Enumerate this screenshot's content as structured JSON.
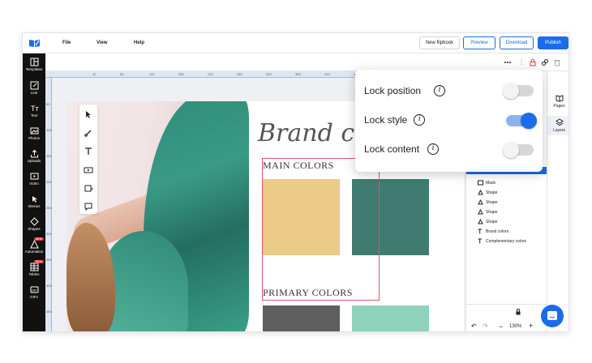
{
  "menu": {
    "file": "File",
    "view": "View",
    "help": "Help"
  },
  "topbar": {
    "new_flipbook": "New flipbook",
    "preview": "Preview",
    "download": "Download",
    "publish": "Publish"
  },
  "leftnav": {
    "items": [
      {
        "label": "Templates",
        "icon": "templates-icon"
      },
      {
        "label": "Link",
        "icon": "link-icon"
      },
      {
        "label": "Text",
        "icon": "text-icon"
      },
      {
        "label": "Photos",
        "icon": "photos-icon"
      },
      {
        "label": "Uploads",
        "icon": "upload-icon"
      },
      {
        "label": "Video",
        "icon": "video-icon"
      },
      {
        "label": "Interact",
        "icon": "interact-icon"
      },
      {
        "label": "Shapes",
        "icon": "shapes-icon"
      },
      {
        "label": "Automation",
        "icon": "automation-icon",
        "badge": "NEW"
      },
      {
        "label": "Tables",
        "icon": "tables-icon",
        "badge": "NEW"
      },
      {
        "label": "GIFs",
        "icon": "gifs-icon"
      }
    ]
  },
  "ruler": {
    "h_ticks": [
      "10",
      "50",
      "110",
      "150",
      "210",
      "250",
      "310",
      "350",
      "410",
      "450",
      "500"
    ],
    "v_ticks": [
      "50",
      "100",
      "150",
      "200",
      "250",
      "300",
      "350",
      "400",
      "450",
      "500"
    ]
  },
  "canvas": {
    "brand_title": "Brand col",
    "main_colors": "MAIN COLORS",
    "primary_colors": "PRIMARY COLORS",
    "swatch_colors": [
      "#ecca87",
      "#3f7b71",
      "#5e5e5e",
      "#8fd2bb"
    ]
  },
  "lock_popup": {
    "rows": [
      {
        "label": "Lock position",
        "on": false
      },
      {
        "label": "Lock style",
        "on": true
      },
      {
        "label": "Lock content",
        "on": false
      }
    ]
  },
  "rail": {
    "pages": "Pages",
    "layers": "Layers"
  },
  "layers": {
    "items": [
      {
        "label": "Mask",
        "icon": "mask-icon"
      },
      {
        "label": "Shape",
        "icon": "shape-icon"
      },
      {
        "label": "Shape",
        "icon": "shape-icon"
      },
      {
        "label": "Shape",
        "icon": "shape-icon"
      },
      {
        "label": "Shape",
        "icon": "shape-icon"
      },
      {
        "label": "Brand colors",
        "icon": "text-layer-icon"
      },
      {
        "label": "Complementary colors",
        "icon": "text-layer-icon"
      }
    ]
  },
  "zoom": {
    "value": "130%"
  },
  "colors": {
    "accent": "#1a6ce8",
    "selection": "#e0526b"
  }
}
